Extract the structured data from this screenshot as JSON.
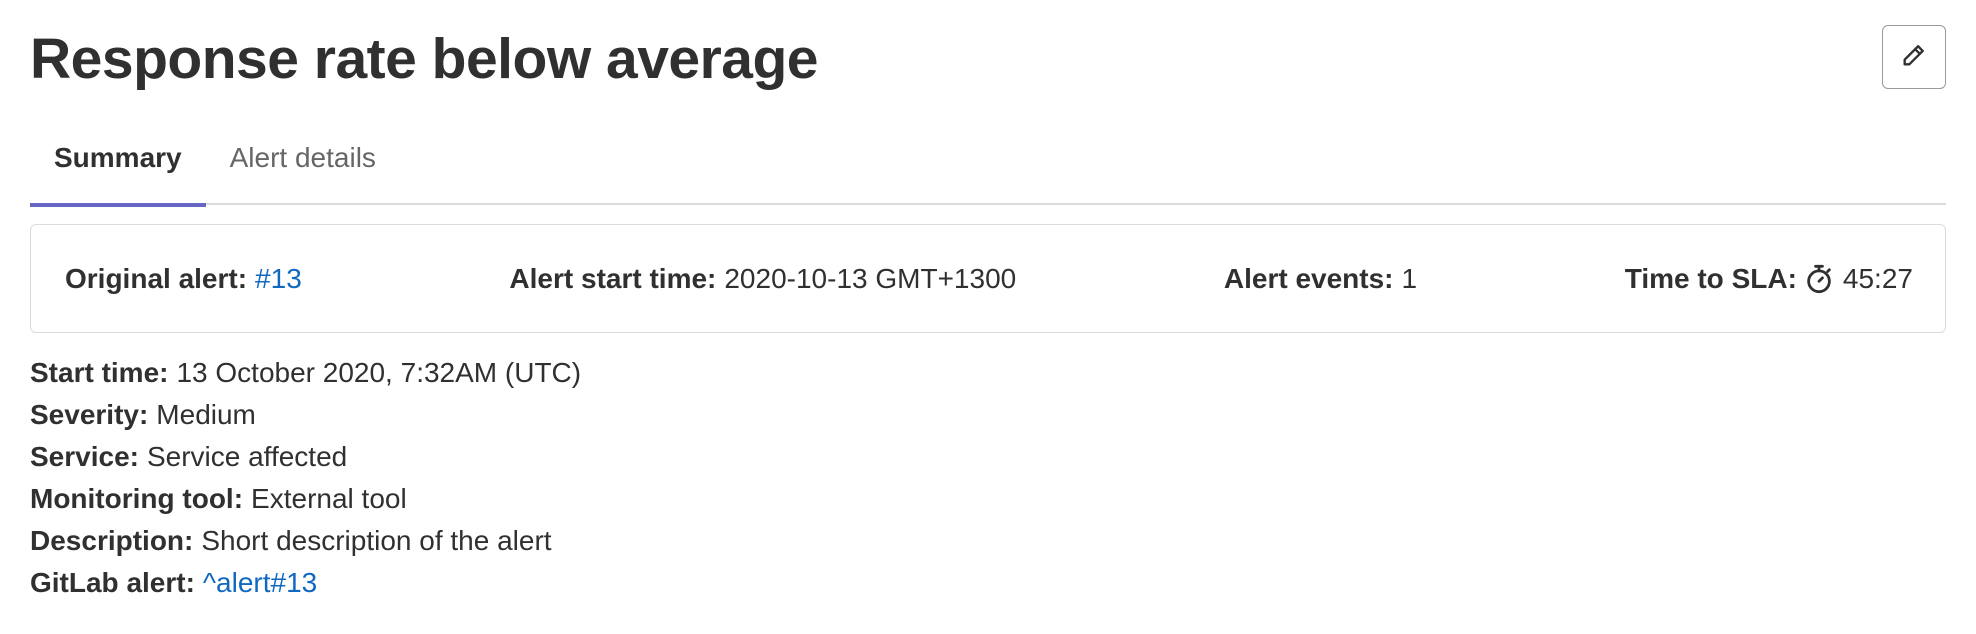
{
  "title": "Response rate below average",
  "edit_button": {
    "icon": "pencil-icon"
  },
  "tabs": [
    {
      "label": "Summary",
      "active": true
    },
    {
      "label": "Alert details",
      "active": false
    }
  ],
  "summary": {
    "original_alert_label": "Original alert:",
    "original_alert_value": "#13",
    "start_time_label": "Alert start time:",
    "start_time_value": "2020-10-13 GMT+1300",
    "events_label": "Alert events:",
    "events_value": "1",
    "sla_label": "Time to SLA:",
    "sla_icon": "timer-icon",
    "sla_value": "45:27"
  },
  "details": {
    "start_time_label": "Start time:",
    "start_time_value": "13 October 2020, 7:32AM (UTC)",
    "severity_label": "Severity:",
    "severity_value": "Medium",
    "service_label": "Service:",
    "service_value": "Service affected",
    "monitoring_tool_label": "Monitoring tool:",
    "monitoring_tool_value": "External tool",
    "description_label": "Description:",
    "description_value": "Short description of the alert",
    "gitlab_alert_label": "GitLab alert:",
    "gitlab_alert_value": "^alert#13"
  },
  "colors": {
    "link": "#1068bf",
    "tab_active_underline": "#6666c4",
    "text": "#303030",
    "border": "#dbdbdb"
  }
}
